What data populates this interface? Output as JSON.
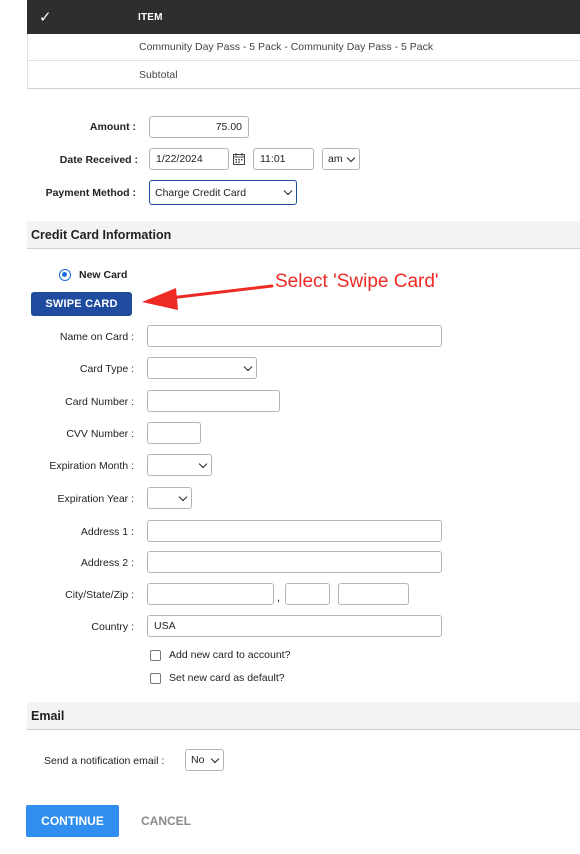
{
  "item_table": {
    "check_glyph": "✓",
    "header_item": "ITEM",
    "rows": [
      "Community Day Pass - 5 Pack - Community Day Pass - 5 Pack",
      "Subtotal"
    ]
  },
  "payment": {
    "amount_label": "Amount :",
    "amount_value": "75.00",
    "date_label": "Date Received :",
    "date_value": "1/22/2024",
    "time_value": "11:01",
    "ampm_value": "am",
    "method_label": "Payment Method :",
    "method_value": "Charge Credit Card"
  },
  "credit_card": {
    "section_title": "Credit Card Information",
    "new_card_label": "New Card",
    "swipe_button": "SWIPE CARD",
    "annotation": "Select 'Swipe Card'",
    "annotation_color": "#ee2a24",
    "fields": {
      "name_on_card": "Name on Card :",
      "card_type": "Card Type :",
      "card_number": "Card Number :",
      "cvv": "CVV Number :",
      "exp_month": "Expiration Month :",
      "exp_year": "Expiration Year :",
      "address1": "Address 1 :",
      "address2": "Address 2 :",
      "city_state_zip": "City/State/Zip :",
      "country": "Country :"
    },
    "country_value": "USA",
    "comma": ",",
    "add_card_label": "Add new card to account?",
    "default_card_label": "Set new card as default?"
  },
  "email": {
    "section_title": "Email",
    "notify_label": "Send a notification email :",
    "notify_value": "No"
  },
  "actions": {
    "continue": "CONTINUE",
    "cancel": "CANCEL"
  },
  "colors": {
    "primary": "#1f4c9e",
    "continue": "#2f8ef0",
    "header_bg": "#2e2e2e"
  }
}
